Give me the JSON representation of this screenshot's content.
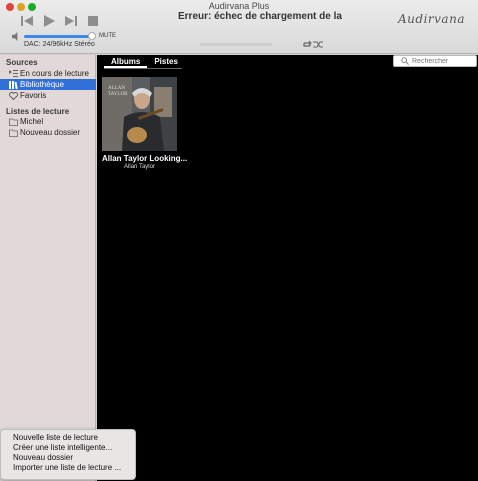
{
  "window": {
    "title": "Audirvana Plus"
  },
  "toolbar": {
    "status": "Erreur: échec de chargement de la",
    "brand": "Audirvana",
    "mute_label": "MUTE",
    "dac_info": "DAC: 24/96kHz Stéréo",
    "volume_level": 0.95,
    "icons": [
      "previous-icon",
      "play-icon",
      "next-icon",
      "stop-icon",
      "speaker-icon",
      "repeat-icon",
      "shuffle-icon"
    ]
  },
  "sidebar": {
    "sources_header": "Sources",
    "sources": [
      {
        "label": "En cours de lecture",
        "icon": "now-playing-icon"
      },
      {
        "label": "Bibliothèque",
        "icon": "library-icon",
        "selected": true
      },
      {
        "label": "Favoris",
        "icon": "heart-icon"
      }
    ],
    "playlists_header": "Listes de lecture",
    "playlists": [
      {
        "label": "Michel",
        "icon": "folder-icon"
      },
      {
        "label": "Nouveau dossier",
        "icon": "folder-icon"
      }
    ]
  },
  "content": {
    "tabs": [
      "Albums",
      "Pistes"
    ],
    "active_tab": "Albums",
    "search_placeholder": "Rechercher",
    "albums": [
      {
        "title": "Allan Taylor Looking...",
        "artist": "Allan Taylor",
        "cover_text_line1": "ALLAN",
        "cover_text_line2": "TAYLOR"
      }
    ]
  },
  "menu": {
    "items": [
      "Nouvelle liste de lecture",
      "Créer une liste intelligente...",
      "Nouveau dossier",
      "Importer une liste de lecture ..."
    ]
  },
  "colors": {
    "accent": "#2f6fd7",
    "content_bg": "#000000",
    "sidebar_bg": "#e2d8d8"
  }
}
